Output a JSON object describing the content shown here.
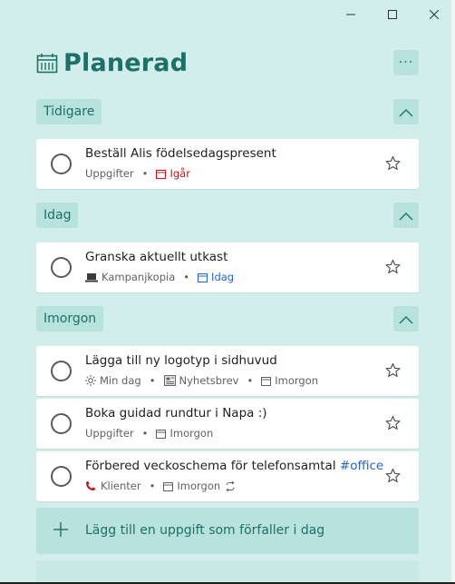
{
  "window": {
    "minimize_icon": "minimize-icon",
    "maximize_icon": "maximize-icon",
    "close_icon": "close-icon"
  },
  "header": {
    "title": "Planerad",
    "icon": "calendar-icon",
    "more_label": "···"
  },
  "colors": {
    "accent": "#1e6f68",
    "background": "#d2eeeb",
    "chip": "#b8e2dd",
    "overdue": "#c5171d",
    "today": "#2564cf"
  },
  "groups": [
    {
      "label": "Tidigare",
      "tasks": [
        {
          "title": "Beställ Alis födelsedagspresent",
          "list": "Uppgifter",
          "due": "Igår"
        }
      ]
    },
    {
      "label": "Idag",
      "tasks": [
        {
          "title": "Granska aktuellt utkast",
          "list": "Kampanjkopia",
          "due": "Idag"
        }
      ]
    },
    {
      "label": "Imorgon",
      "tasks": [
        {
          "title": "Lägga till ny logotyp i sidhuvud",
          "myday": "Min dag",
          "list": "Nyhetsbrev",
          "due": "Imorgon"
        },
        {
          "title": "Boka guidad rundtur i Napa :)",
          "list": "Uppgifter",
          "due": "Imorgon"
        },
        {
          "title": "Förbered veckoschema för telefonsamtal",
          "tag": "#office",
          "list": "Klienter",
          "due": "Imorgon"
        }
      ]
    }
  ],
  "add_task": {
    "label": "Lägg till en uppgift som förfaller i dag"
  }
}
